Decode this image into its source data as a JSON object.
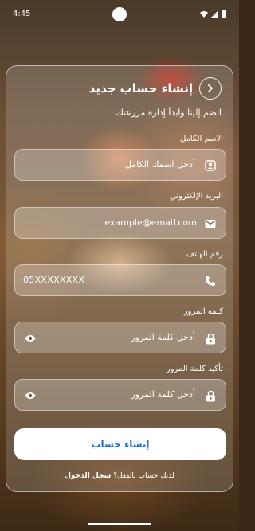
{
  "status_bar": {
    "time": "4:45"
  },
  "header": {
    "title": "إنشاء حساب جديد"
  },
  "subtitle": "انضم إلينا وابدأ إدارة مزرعتك.",
  "fields": {
    "full_name": {
      "label": "الاسم الكامل",
      "placeholder": "أدخل اسمك الكامل"
    },
    "email": {
      "label": "البريد الإلكتروني",
      "placeholder": "example@email.com"
    },
    "phone": {
      "label": "رقم الهاتف",
      "placeholder": "05XXXXXXXX"
    },
    "password": {
      "label": "كلمة المرور",
      "placeholder": "أدخل كلمة المرور"
    },
    "confirm_password": {
      "label": "تأكيد كلمة المرور",
      "placeholder": "أدخل كلمة المرور"
    }
  },
  "submit_label": "إنشاء حساب",
  "login": {
    "prompt": "لديك حساب بالفعل؟",
    "link": "سجل الدخول"
  },
  "colors": {
    "accent": "#1e6fe0"
  },
  "icons": {
    "back": "chevron-right-icon",
    "name": "person-icon",
    "email": "mail-icon",
    "phone": "phone-icon",
    "lock": "lock-icon",
    "eye": "eye-icon"
  }
}
